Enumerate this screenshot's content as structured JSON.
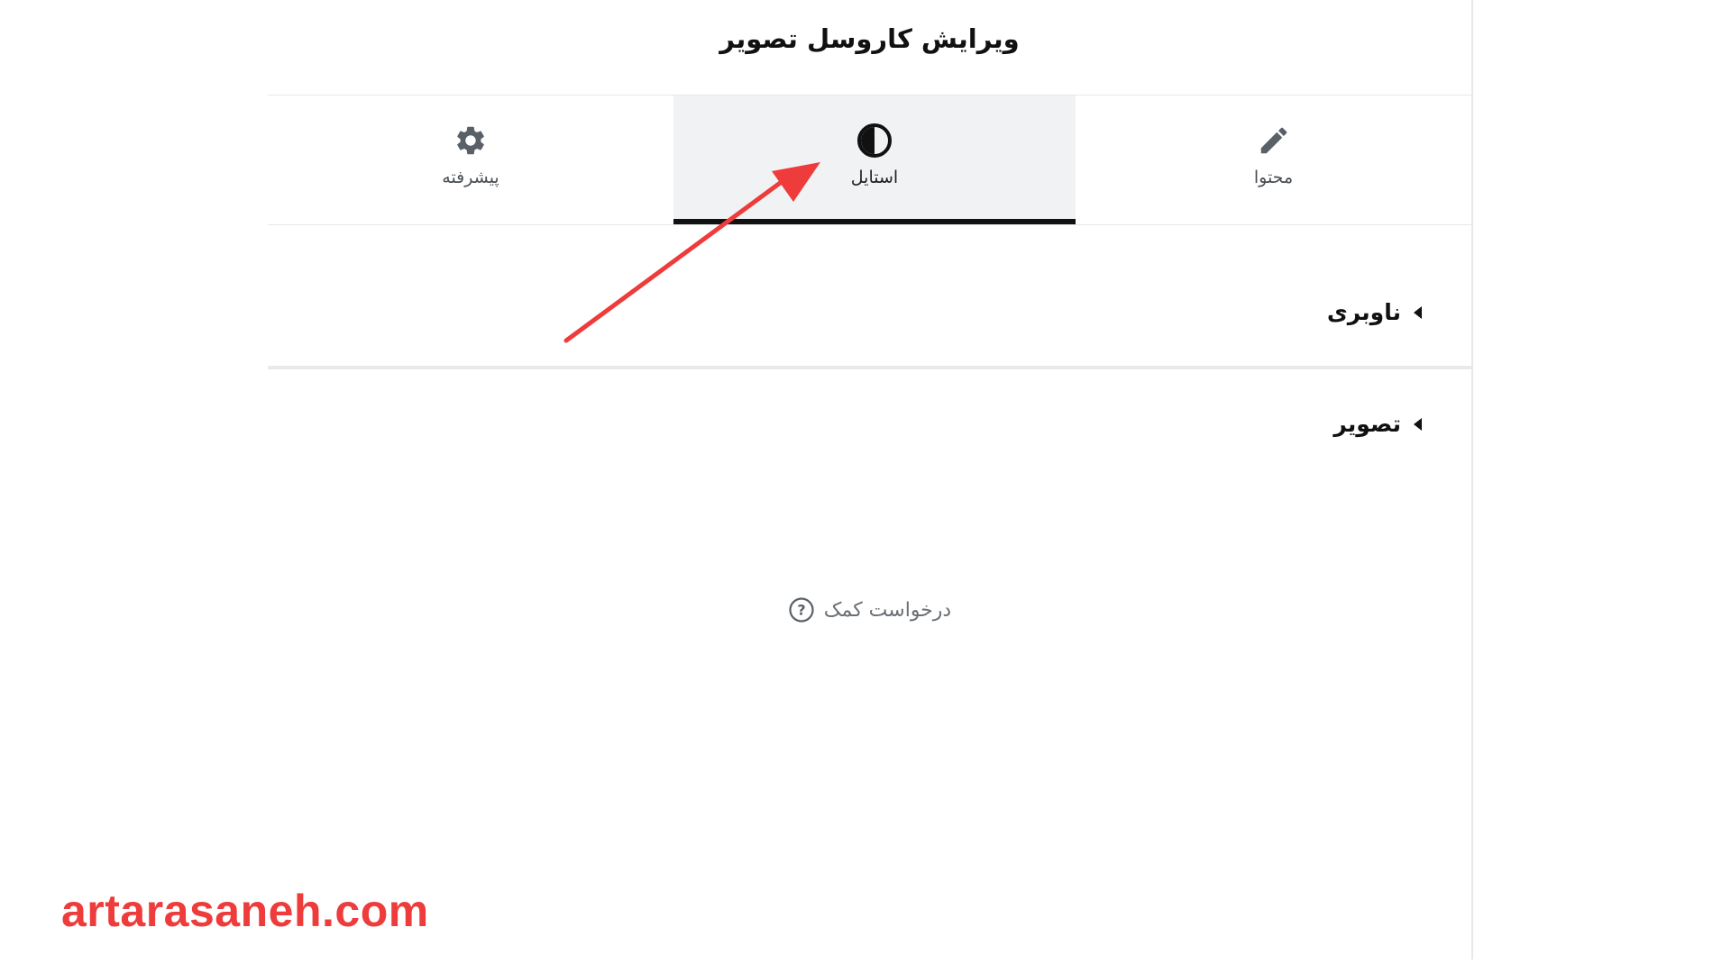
{
  "header": {
    "title": "ویرایش کاروسل تصویر"
  },
  "tabs": [
    {
      "id": "advanced",
      "label": "پیشرفته",
      "icon": "gear-icon"
    },
    {
      "id": "style",
      "label": "استایل",
      "icon": "contrast-icon",
      "active": true
    },
    {
      "id": "content",
      "label": "محتوا",
      "icon": "pencil-icon"
    }
  ],
  "sections": [
    {
      "label": "ناوبری"
    },
    {
      "label": "تصویر"
    }
  ],
  "help": {
    "label": "درخواست کمک",
    "icon": "question-circle-icon"
  },
  "watermark": {
    "text": "artarasaneh.com"
  },
  "colors": {
    "accent_arrow": "#ee3b3b",
    "active_tab_bg": "#f1f2f4",
    "active_tab_border": "#111111",
    "icon_color": "#5a6068"
  }
}
